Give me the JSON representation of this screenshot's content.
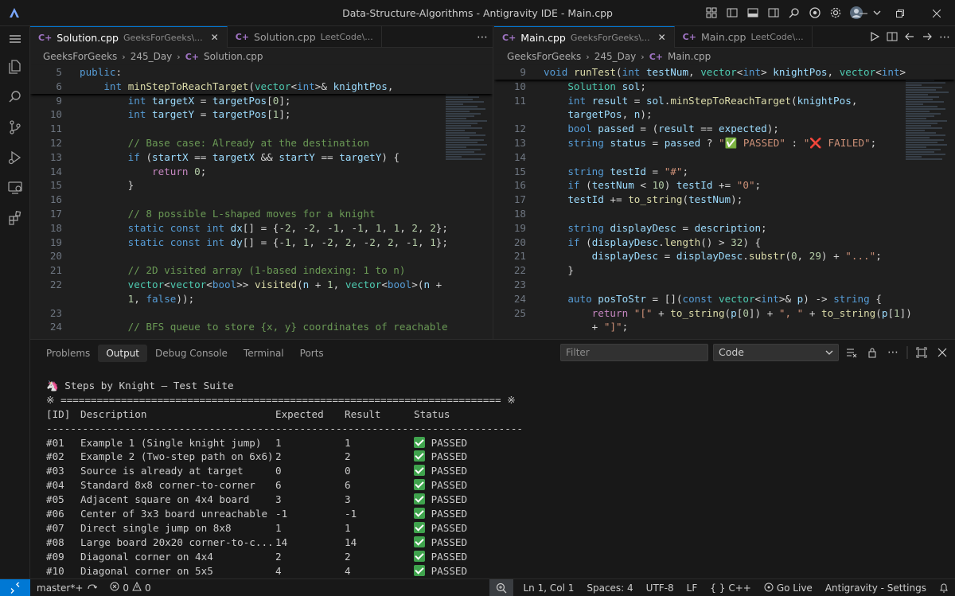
{
  "window": {
    "title": "Data-Structure-Algorithms - Antigravity IDE - Main.cpp"
  },
  "activity_bar": [
    "explorer-icon",
    "search-icon",
    "source-control-icon",
    "run-debug-icon",
    "remote-explorer-icon",
    "extensions-icon"
  ],
  "left_editor": {
    "tabs": [
      {
        "name": "Solution.cpp",
        "path": "GeeksForGeeks\\...",
        "active": true
      },
      {
        "name": "Solution.cpp",
        "path": "LeetCode\\...",
        "active": false
      }
    ],
    "breadcrumb": [
      "GeeksForGeeks",
      "245_Day",
      "Solution.cpp"
    ],
    "sticky": [
      {
        "n": "5",
        "t": "public:"
      },
      {
        "n": "6",
        "t": "    int minStepToReachTarget(vector<int>& knightPos,"
      }
    ],
    "lines": [
      {
        "n": "9",
        "t": "        int targetX = targetPos[0];"
      },
      {
        "n": "10",
        "t": "        int targetY = targetPos[1];"
      },
      {
        "n": "11",
        "t": ""
      },
      {
        "n": "12",
        "t": "        // Base case: Already at the destination"
      },
      {
        "n": "13",
        "t": "        if (startX == targetX && startY == targetY) {"
      },
      {
        "n": "14",
        "t": "            return 0;"
      },
      {
        "n": "15",
        "t": "        }"
      },
      {
        "n": "16",
        "t": ""
      },
      {
        "n": "17",
        "t": "        // 8 possible L-shaped moves for a knight"
      },
      {
        "n": "18",
        "t": "        static const int dx[] = {-2, -2, -1, -1, 1, 1, 2, 2};"
      },
      {
        "n": "19",
        "t": "        static const int dy[] = {-1, 1, -2, 2, -2, 2, -1, 1};"
      },
      {
        "n": "20",
        "t": ""
      },
      {
        "n": "21",
        "t": "        // 2D visited array (1-based indexing: 1 to n)"
      },
      {
        "n": "22",
        "t": "        vector<vector<bool>> visited(n + 1, vector<bool>(n +"
      },
      {
        "n": "",
        "t": "        1, false));"
      },
      {
        "n": "23",
        "t": ""
      },
      {
        "n": "24",
        "t": "        // BFS queue to store {x, y} coordinates of reachable"
      }
    ]
  },
  "right_editor": {
    "tabs": [
      {
        "name": "Main.cpp",
        "path": "GeeksForGeeks\\...",
        "active": true
      },
      {
        "name": "Main.cpp",
        "path": "LeetCode\\...",
        "active": false
      }
    ],
    "breadcrumb": [
      "GeeksForGeeks",
      "245_Day",
      "Main.cpp"
    ],
    "sticky": [
      {
        "n": "9",
        "t": "void runTest(int testNum, vector<int> knightPos, vector<int>"
      }
    ],
    "lines": [
      {
        "n": "10",
        "t": "    Solution sol;"
      },
      {
        "n": "11",
        "t": "    int result = sol.minStepToReachTarget(knightPos,"
      },
      {
        "n": "",
        "t": "    targetPos, n);"
      },
      {
        "n": "12",
        "t": "    bool passed = (result == expected);"
      },
      {
        "n": "13",
        "t": "    string status = passed ? \"✅ PASSED\" : \"❌ FAILED\";"
      },
      {
        "n": "14",
        "t": ""
      },
      {
        "n": "15",
        "t": "    string testId = \"#\";"
      },
      {
        "n": "16",
        "t": "    if (testNum < 10) testId += \"0\";"
      },
      {
        "n": "17",
        "t": "    testId += to_string(testNum);"
      },
      {
        "n": "18",
        "t": ""
      },
      {
        "n": "19",
        "t": "    string displayDesc = description;"
      },
      {
        "n": "20",
        "t": "    if (displayDesc.length() > 32) {"
      },
      {
        "n": "21",
        "t": "        displayDesc = displayDesc.substr(0, 29) + \"...\";"
      },
      {
        "n": "22",
        "t": "    }"
      },
      {
        "n": "23",
        "t": ""
      },
      {
        "n": "24",
        "t": "    auto posToStr = [](const vector<int>& p) -> string {"
      },
      {
        "n": "25",
        "t": "        return \"[\" + to_string(p[0]) + \", \" + to_string(p[1])"
      },
      {
        "n": "",
        "t": "        + \"]\";"
      }
    ]
  },
  "panel": {
    "tabs": [
      "Problems",
      "Output",
      "Debug Console",
      "Terminal",
      "Ports"
    ],
    "active_tab": "Output",
    "filter_placeholder": "Filter",
    "channel": "Code",
    "output_title": "🦄 Steps by Knight — Test Suite",
    "rule_top": "※ ========================================================================= ※",
    "headers": {
      "id": "[ID]",
      "desc": "Description",
      "expected": "Expected",
      "result": "Result",
      "status": "Status"
    },
    "rule_mid": "-------------------------------------------------------------------------------",
    "rows": [
      {
        "id": "#01",
        "desc": "Example 1 (Single knight jump)",
        "expected": "1",
        "result": "1",
        "status": "PASSED"
      },
      {
        "id": "#02",
        "desc": "Example 2 (Two-step path on 6x6)",
        "expected": "2",
        "result": "2",
        "status": "PASSED"
      },
      {
        "id": "#03",
        "desc": "Source is already at target",
        "expected": "0",
        "result": "0",
        "status": "PASSED"
      },
      {
        "id": "#04",
        "desc": "Standard 8x8 corner-to-corner",
        "expected": "6",
        "result": "6",
        "status": "PASSED"
      },
      {
        "id": "#05",
        "desc": "Adjacent square on 4x4 board",
        "expected": "3",
        "result": "3",
        "status": "PASSED"
      },
      {
        "id": "#06",
        "desc": "Center of 3x3 board unreachable",
        "expected": "-1",
        "result": "-1",
        "status": "PASSED"
      },
      {
        "id": "#07",
        "desc": "Direct single jump on 8x8",
        "expected": "1",
        "result": "1",
        "status": "PASSED"
      },
      {
        "id": "#08",
        "desc": "Large board 20x20 corner-to-c...",
        "expected": "14",
        "result": "14",
        "status": "PASSED"
      },
      {
        "id": "#09",
        "desc": "Diagonal corner on 4x4",
        "expected": "2",
        "result": "2",
        "status": "PASSED"
      },
      {
        "id": "#10",
        "desc": "Diagonal corner on 5x5",
        "expected": "4",
        "result": "4",
        "status": "PASSED"
      }
    ]
  },
  "statusbar": {
    "branch": "master*+",
    "errors": "0",
    "warnings": "0",
    "cursor": "Ln 1, Col 1",
    "spaces": "Spaces: 4",
    "encoding": "UTF-8",
    "eol": "LF",
    "language": "C++",
    "golive": "Go Live",
    "settings": "Antigravity - Settings"
  },
  "colors": {
    "accent": "#0078d4",
    "pass": "#3fa34d"
  }
}
